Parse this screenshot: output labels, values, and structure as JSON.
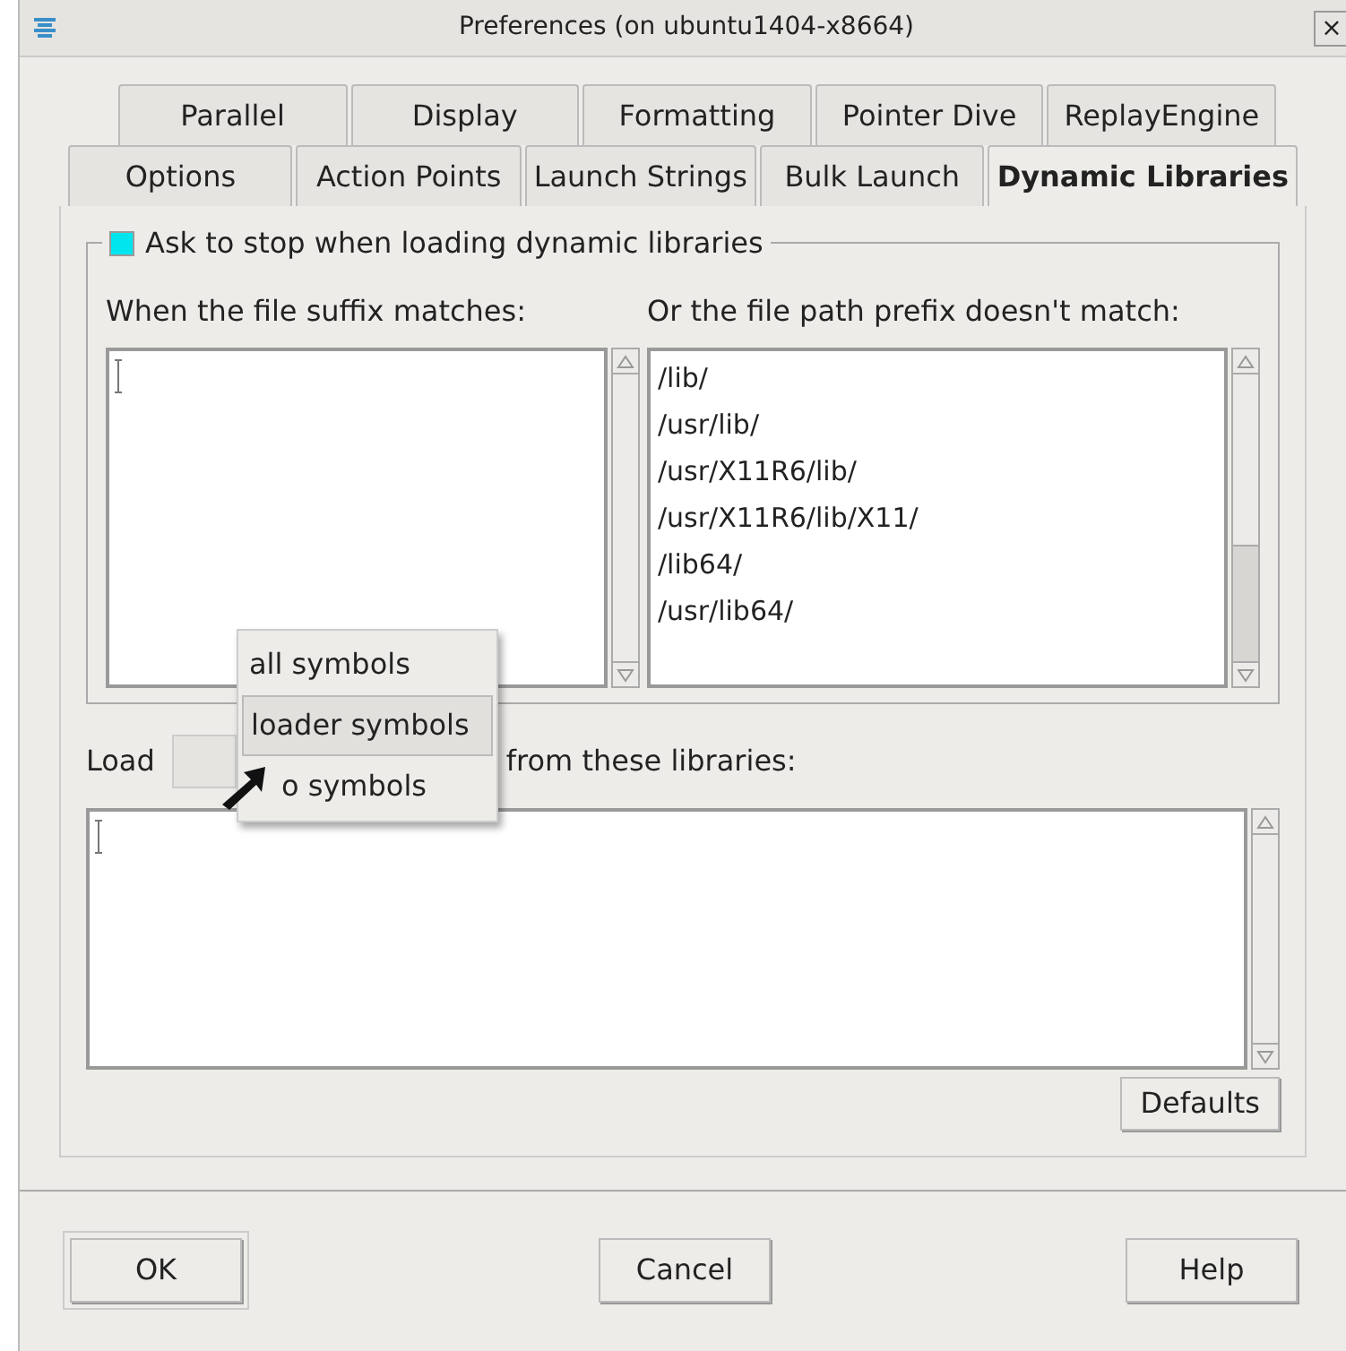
{
  "window": {
    "title": "Preferences (on ubuntu1404-x8664)",
    "close": "×"
  },
  "tab_rows": [
    [
      {
        "label": "Parallel",
        "selected": false
      },
      {
        "label": "Display",
        "selected": false
      },
      {
        "label": "Formatting",
        "selected": false
      },
      {
        "label": "Pointer Dive",
        "selected": false
      },
      {
        "label": "ReplayEngine",
        "selected": false
      }
    ],
    [
      {
        "label": "Options",
        "selected": false
      },
      {
        "label": "Action Points",
        "selected": false
      },
      {
        "label": "Launch Strings",
        "selected": false
      },
      {
        "label": "Bulk Launch",
        "selected": false
      },
      {
        "label": "Dynamic Libraries",
        "selected": true
      }
    ]
  ],
  "ask_checkbox": {
    "label": "Ask to stop when loading dynamic libraries",
    "checked": true
  },
  "suffix_list": {
    "label": "When the file suffix matches:"
  },
  "prefix_list": {
    "label": "Or the file path prefix doesn't match:",
    "items": [
      "/lib/",
      "/usr/lib/",
      "/usr/X11R6/lib/",
      "/usr/X11R6/lib/X11/",
      "/lib64/",
      "/usr/lib64/"
    ]
  },
  "load_row": {
    "label": "Load",
    "suffix": "from these libraries:"
  },
  "load_menu": [
    {
      "label": "all symbols",
      "selected": false
    },
    {
      "label": "loader symbols",
      "selected": true
    },
    {
      "label": "o symbols",
      "selected": false
    }
  ],
  "defaults_button": "Defaults",
  "buttons": [
    "OK",
    "Cancel",
    "Help"
  ]
}
